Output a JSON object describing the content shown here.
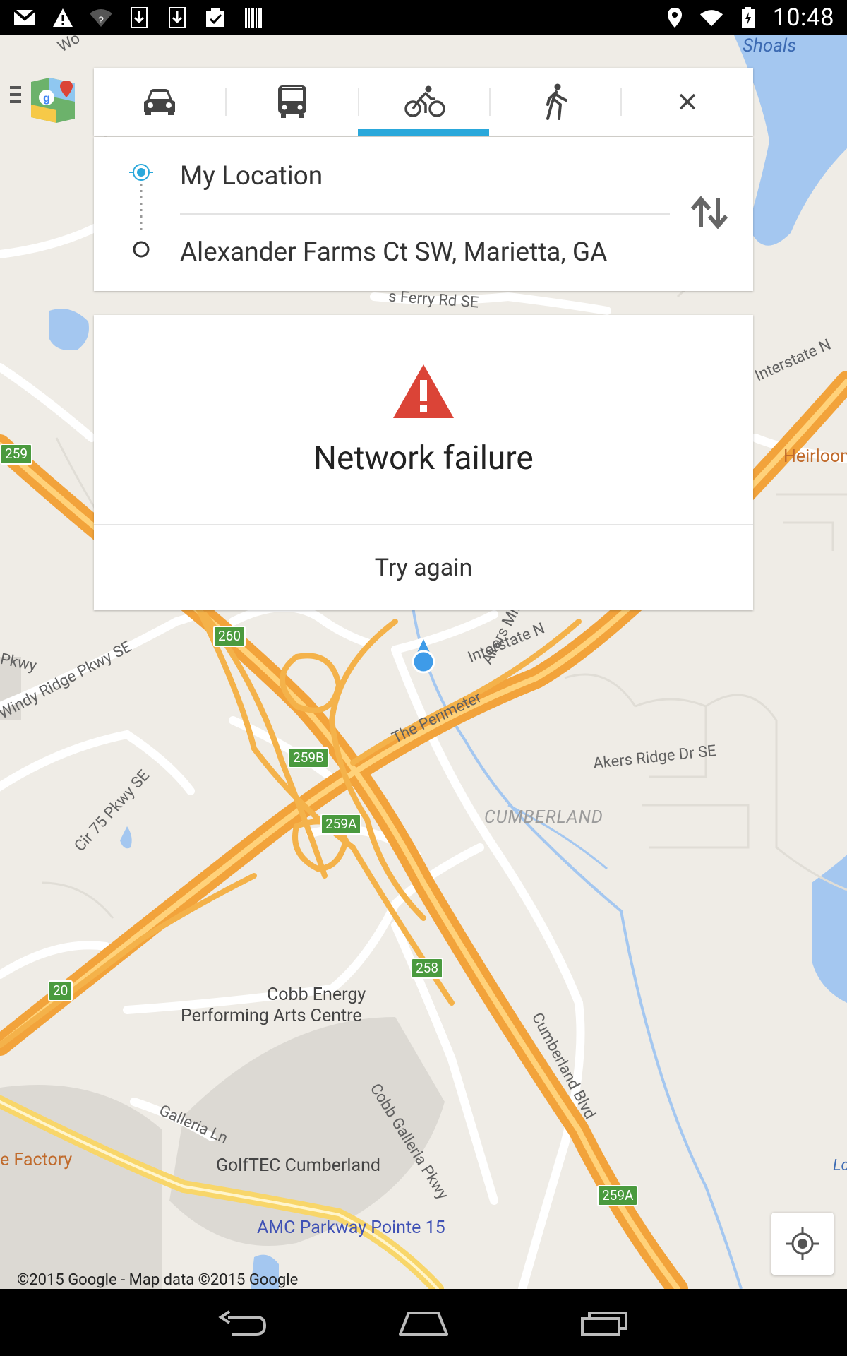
{
  "status_bar": {
    "time": "10:48",
    "left_icons": [
      "gmail-icon",
      "alert-icon",
      "wifi-question-icon",
      "download-icon",
      "download-icon",
      "clipboard-check-icon",
      "barcode-icon"
    ],
    "right_icons": [
      "location-icon",
      "wifi-icon",
      "battery-icon"
    ]
  },
  "modes": [
    {
      "name": "car",
      "icon": "car-icon"
    },
    {
      "name": "transit",
      "icon": "bus-icon"
    },
    {
      "name": "bike",
      "icon": "bicycle-icon",
      "active": true
    },
    {
      "name": "walk",
      "icon": "walking-icon"
    }
  ],
  "route": {
    "origin": "My Location",
    "destination": "Alexander Farms Ct SW, Marietta, GA"
  },
  "error": {
    "title": "Network failure",
    "retry_label": "Try again"
  },
  "map": {
    "labels": {
      "shoals": "Shoals",
      "ferry_rd": "s Ferry Rd SE",
      "interstate_ne": "Interstate N",
      "heirloom": "Heirloom",
      "pkwy": "Pkwy",
      "windy_ridge": "Windy Ridge Pkwy SE",
      "interstate_n": "Interstate N",
      "akers_mill": "Akers Mill Rd SE",
      "the_perimeter": "The Perimeter",
      "akers_ridge": "Akers Ridge Dr SE",
      "cumberland": "CUMBERLAND",
      "cir75": "Cir 75 Pkwy SE",
      "cobb_energy_1": "Cobb Energy",
      "cobb_energy_2": "Performing Arts Centre",
      "cumberland_blvd": "Cumberland Blvd",
      "cobb_galleria": "Cobb Galleria Pkwy",
      "galleria_ln": "Galleria Ln",
      "factory": "e Factory",
      "golftec": "GolfTEC Cumberland",
      "amc": "AMC Parkway Pointe 15",
      "lo": "Lo",
      "wo": "Wo"
    },
    "shields": {
      "s259": "259",
      "s260": "260",
      "s259b": "259B",
      "s259a": "259A",
      "s258": "258",
      "s20": "20",
      "s259a2": "259A"
    },
    "copyright": "©2015 Google - Map data ©2015 Google"
  },
  "colors": {
    "accent": "#2aa8db",
    "error": "#db4437",
    "highway": "#f5a623",
    "water": "#a4c7f0"
  }
}
